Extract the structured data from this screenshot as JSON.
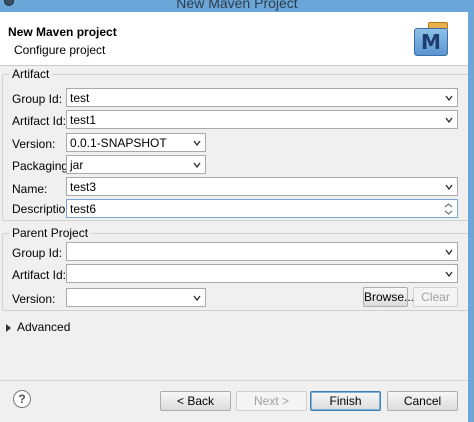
{
  "window": {
    "title": "New Maven Project"
  },
  "header": {
    "title": "New Maven project",
    "description": "Configure project",
    "logo_letter": "M"
  },
  "artifact": {
    "legend": "Artifact",
    "group_id": {
      "label": "Group Id:",
      "value": "test"
    },
    "artifact_id": {
      "label": "Artifact Id:",
      "value": "test1"
    },
    "version": {
      "label": "Version:",
      "value": "0.0.1-SNAPSHOT"
    },
    "packaging": {
      "label": "Packaging:",
      "value": "jar"
    },
    "name": {
      "label": "Name:",
      "value": "test3"
    },
    "description": {
      "label": "Description:",
      "value": "test6"
    }
  },
  "parent": {
    "legend": "Parent Project",
    "group_id": {
      "label": "Group Id:",
      "value": ""
    },
    "artifact_id": {
      "label": "Artifact Id:",
      "value": ""
    },
    "version": {
      "label": "Version:",
      "value": ""
    },
    "browse_label": "Browse...",
    "clear_label": "Clear"
  },
  "advanced": {
    "label": "Advanced"
  },
  "footer": {
    "help": "?",
    "back": "< Back",
    "next": "Next >",
    "finish": "Finish",
    "cancel": "Cancel"
  }
}
